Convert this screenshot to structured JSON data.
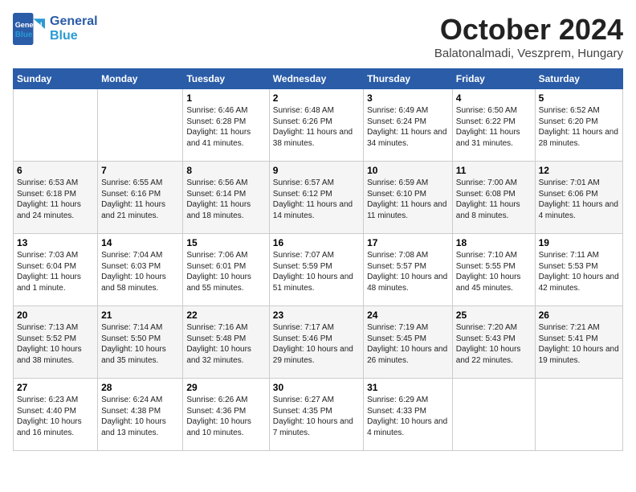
{
  "logo": {
    "general": "General",
    "blue": "Blue"
  },
  "title": "October 2024",
  "subtitle": "Balatonalmadi, Veszprem, Hungary",
  "days_of_week": [
    "Sunday",
    "Monday",
    "Tuesday",
    "Wednesday",
    "Thursday",
    "Friday",
    "Saturday"
  ],
  "weeks": [
    [
      {
        "num": "",
        "sunrise": "",
        "sunset": "",
        "daylight": ""
      },
      {
        "num": "",
        "sunrise": "",
        "sunset": "",
        "daylight": ""
      },
      {
        "num": "1",
        "sunrise": "Sunrise: 6:46 AM",
        "sunset": "Sunset: 6:28 PM",
        "daylight": "Daylight: 11 hours and 41 minutes."
      },
      {
        "num": "2",
        "sunrise": "Sunrise: 6:48 AM",
        "sunset": "Sunset: 6:26 PM",
        "daylight": "Daylight: 11 hours and 38 minutes."
      },
      {
        "num": "3",
        "sunrise": "Sunrise: 6:49 AM",
        "sunset": "Sunset: 6:24 PM",
        "daylight": "Daylight: 11 hours and 34 minutes."
      },
      {
        "num": "4",
        "sunrise": "Sunrise: 6:50 AM",
        "sunset": "Sunset: 6:22 PM",
        "daylight": "Daylight: 11 hours and 31 minutes."
      },
      {
        "num": "5",
        "sunrise": "Sunrise: 6:52 AM",
        "sunset": "Sunset: 6:20 PM",
        "daylight": "Daylight: 11 hours and 28 minutes."
      }
    ],
    [
      {
        "num": "6",
        "sunrise": "Sunrise: 6:53 AM",
        "sunset": "Sunset: 6:18 PM",
        "daylight": "Daylight: 11 hours and 24 minutes."
      },
      {
        "num": "7",
        "sunrise": "Sunrise: 6:55 AM",
        "sunset": "Sunset: 6:16 PM",
        "daylight": "Daylight: 11 hours and 21 minutes."
      },
      {
        "num": "8",
        "sunrise": "Sunrise: 6:56 AM",
        "sunset": "Sunset: 6:14 PM",
        "daylight": "Daylight: 11 hours and 18 minutes."
      },
      {
        "num": "9",
        "sunrise": "Sunrise: 6:57 AM",
        "sunset": "Sunset: 6:12 PM",
        "daylight": "Daylight: 11 hours and 14 minutes."
      },
      {
        "num": "10",
        "sunrise": "Sunrise: 6:59 AM",
        "sunset": "Sunset: 6:10 PM",
        "daylight": "Daylight: 11 hours and 11 minutes."
      },
      {
        "num": "11",
        "sunrise": "Sunrise: 7:00 AM",
        "sunset": "Sunset: 6:08 PM",
        "daylight": "Daylight: 11 hours and 8 minutes."
      },
      {
        "num": "12",
        "sunrise": "Sunrise: 7:01 AM",
        "sunset": "Sunset: 6:06 PM",
        "daylight": "Daylight: 11 hours and 4 minutes."
      }
    ],
    [
      {
        "num": "13",
        "sunrise": "Sunrise: 7:03 AM",
        "sunset": "Sunset: 6:04 PM",
        "daylight": "Daylight: 11 hours and 1 minute."
      },
      {
        "num": "14",
        "sunrise": "Sunrise: 7:04 AM",
        "sunset": "Sunset: 6:03 PM",
        "daylight": "Daylight: 10 hours and 58 minutes."
      },
      {
        "num": "15",
        "sunrise": "Sunrise: 7:06 AM",
        "sunset": "Sunset: 6:01 PM",
        "daylight": "Daylight: 10 hours and 55 minutes."
      },
      {
        "num": "16",
        "sunrise": "Sunrise: 7:07 AM",
        "sunset": "Sunset: 5:59 PM",
        "daylight": "Daylight: 10 hours and 51 minutes."
      },
      {
        "num": "17",
        "sunrise": "Sunrise: 7:08 AM",
        "sunset": "Sunset: 5:57 PM",
        "daylight": "Daylight: 10 hours and 48 minutes."
      },
      {
        "num": "18",
        "sunrise": "Sunrise: 7:10 AM",
        "sunset": "Sunset: 5:55 PM",
        "daylight": "Daylight: 10 hours and 45 minutes."
      },
      {
        "num": "19",
        "sunrise": "Sunrise: 7:11 AM",
        "sunset": "Sunset: 5:53 PM",
        "daylight": "Daylight: 10 hours and 42 minutes."
      }
    ],
    [
      {
        "num": "20",
        "sunrise": "Sunrise: 7:13 AM",
        "sunset": "Sunset: 5:52 PM",
        "daylight": "Daylight: 10 hours and 38 minutes."
      },
      {
        "num": "21",
        "sunrise": "Sunrise: 7:14 AM",
        "sunset": "Sunset: 5:50 PM",
        "daylight": "Daylight: 10 hours and 35 minutes."
      },
      {
        "num": "22",
        "sunrise": "Sunrise: 7:16 AM",
        "sunset": "Sunset: 5:48 PM",
        "daylight": "Daylight: 10 hours and 32 minutes."
      },
      {
        "num": "23",
        "sunrise": "Sunrise: 7:17 AM",
        "sunset": "Sunset: 5:46 PM",
        "daylight": "Daylight: 10 hours and 29 minutes."
      },
      {
        "num": "24",
        "sunrise": "Sunrise: 7:19 AM",
        "sunset": "Sunset: 5:45 PM",
        "daylight": "Daylight: 10 hours and 26 minutes."
      },
      {
        "num": "25",
        "sunrise": "Sunrise: 7:20 AM",
        "sunset": "Sunset: 5:43 PM",
        "daylight": "Daylight: 10 hours and 22 minutes."
      },
      {
        "num": "26",
        "sunrise": "Sunrise: 7:21 AM",
        "sunset": "Sunset: 5:41 PM",
        "daylight": "Daylight: 10 hours and 19 minutes."
      }
    ],
    [
      {
        "num": "27",
        "sunrise": "Sunrise: 6:23 AM",
        "sunset": "Sunset: 4:40 PM",
        "daylight": "Daylight: 10 hours and 16 minutes."
      },
      {
        "num": "28",
        "sunrise": "Sunrise: 6:24 AM",
        "sunset": "Sunset: 4:38 PM",
        "daylight": "Daylight: 10 hours and 13 minutes."
      },
      {
        "num": "29",
        "sunrise": "Sunrise: 6:26 AM",
        "sunset": "Sunset: 4:36 PM",
        "daylight": "Daylight: 10 hours and 10 minutes."
      },
      {
        "num": "30",
        "sunrise": "Sunrise: 6:27 AM",
        "sunset": "Sunset: 4:35 PM",
        "daylight": "Daylight: 10 hours and 7 minutes."
      },
      {
        "num": "31",
        "sunrise": "Sunrise: 6:29 AM",
        "sunset": "Sunset: 4:33 PM",
        "daylight": "Daylight: 10 hours and 4 minutes."
      },
      {
        "num": "",
        "sunrise": "",
        "sunset": "",
        "daylight": ""
      },
      {
        "num": "",
        "sunrise": "",
        "sunset": "",
        "daylight": ""
      }
    ]
  ]
}
